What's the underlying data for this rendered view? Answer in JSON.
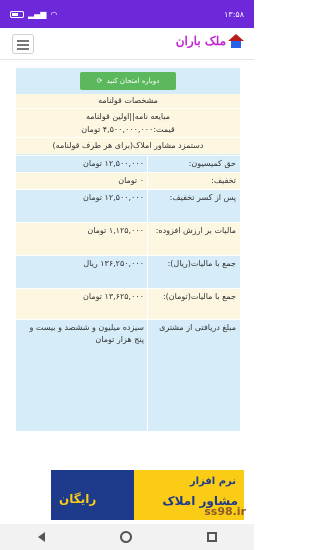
{
  "status_bar": {
    "time": "۱۳:۵۸",
    "battery": "",
    "icons": [
      "wifi-icon",
      "signal-icon"
    ]
  },
  "app": {
    "logo_text": "ملک باران"
  },
  "retry_button": {
    "label": "دوباره امتحان کنید",
    "icon": "refresh-icon"
  },
  "details": {
    "section_title": "مشخصات قولنامه",
    "contract_type": "مبایعه نامه||اولین قولنامه",
    "price": "قیمت:۴,۵۰۰,۰۰۰,۰۰۰ تومان",
    "note": "دستمزد مشاور املاک(برای هر طرف قولنامه)"
  },
  "rows": [
    {
      "label": "حق کمیسیون:",
      "value": "۱۲,۵۰۰,۰۰۰ تومان"
    },
    {
      "label": "تخفیف:",
      "value": "۰ تومان"
    },
    {
      "label": "پس از کسر تخفیف:",
      "value": "۱۲,۵۰۰,۰۰۰ تومان"
    },
    {
      "label": "مالیات بر ارزش افزوده:",
      "value": "۱,۱۲۵,۰۰۰ تومان"
    },
    {
      "label": "جمع با مالیات(ریال):",
      "value": "۱۳۶,۲۵۰,۰۰۰ ریال"
    },
    {
      "label": "جمع با مالیات(تومان):",
      "value": "۱۳,۶۲۵,۰۰۰ تومان"
    },
    {
      "label": "مبلغ دریافتی از مشتری",
      "value": "سیزده میلیون و ششصد و بیست و پنج هزار تومان"
    }
  ],
  "ad": {
    "line1": "نرم افزار",
    "line2": "مشاور املاک",
    "free": "رایگان"
  },
  "watermark": "ss98.ir"
}
